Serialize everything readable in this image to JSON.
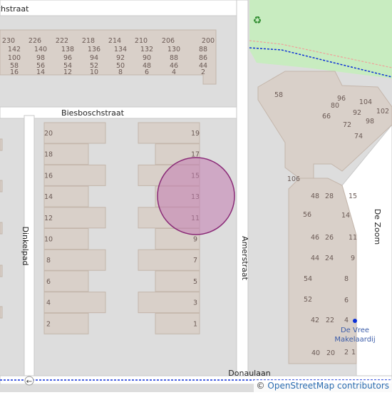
{
  "map": {
    "streets": {
      "top": "chstraat",
      "biesbosch": "Biesboschstraat",
      "dinkelpad": "Dinkelpad",
      "amerstraat": "Amerstraat",
      "donaulaan": "Donaulaan",
      "dezoom": "De Zoom"
    },
    "poi": {
      "makelaardij_line1": "De Vree",
      "makelaardij_line2": "Makelaardij",
      "recycling_icon": "recycling-icon"
    },
    "top_block_numbers": {
      "row1": [
        "230",
        "226",
        "222",
        "218",
        "214",
        "210",
        "206",
        "200"
      ],
      "row2": [
        "142",
        "140",
        "138",
        "136",
        "134",
        "132",
        "130",
        "88"
      ],
      "row3": [
        "100",
        "98",
        "96",
        "94",
        "92",
        "90",
        "88",
        "86"
      ],
      "row4": [
        "58",
        "56",
        "54",
        "52",
        "50",
        "48",
        "46",
        "44"
      ],
      "row5": [
        "16",
        "14",
        "12",
        "10",
        "8",
        "6",
        "4",
        "2"
      ]
    },
    "left_row_numbers": [
      "20",
      "18",
      "16",
      "14",
      "12",
      "10",
      "8",
      "6",
      "4",
      "2"
    ],
    "right_row_numbers": [
      "19",
      "17",
      "15",
      "13",
      "11",
      "9",
      "7",
      "5",
      "3",
      "1"
    ],
    "east_block_numbers": [
      "58",
      "96",
      "104",
      "80",
      "92",
      "102",
      "66",
      "72",
      "98",
      "74",
      "106",
      "48",
      "28",
      "15",
      "56",
      "14",
      "46",
      "26",
      "11",
      "44",
      "24",
      "9",
      "54",
      "8",
      "52",
      "6",
      "42",
      "22",
      "4",
      "40",
      "20",
      "2",
      "1"
    ],
    "colors": {
      "background": "#dddddd",
      "building": "#d9d0c9",
      "building_stroke": "#c4b6ab",
      "park": "#c8ecc0",
      "road": "#ffffff",
      "road_stroke": "#c9c9c9",
      "marker_fill": "#c27bb0",
      "marker_stroke": "#8a2a77",
      "path_blue": "#0b2fd6",
      "path_red": "#f0a09a"
    }
  },
  "attribution": {
    "copyright": "©",
    "link_text": "OpenStreetMap contributors"
  }
}
